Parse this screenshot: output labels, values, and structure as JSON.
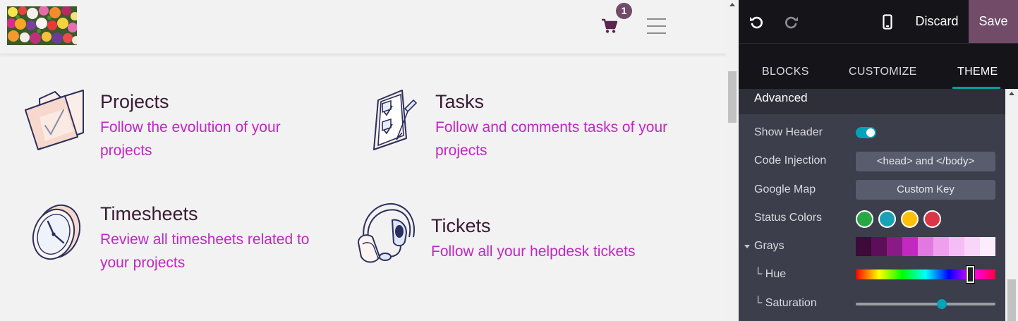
{
  "header": {
    "cart_count": "1",
    "logo_icon": "flower-photo",
    "cart_icon": "shopping-cart-icon",
    "menu_icon": "hamburger-menu-icon"
  },
  "features": [
    {
      "title": "Projects",
      "description": "Follow the evolution of your projects",
      "icon": "folder-check-icon"
    },
    {
      "title": "Tasks",
      "description": "Follow and comments tasks of your projects",
      "icon": "checklist-clipboard-icon"
    },
    {
      "title": "Timesheets",
      "description": "Review all timesheets related to your projects",
      "icon": "clock-icon"
    },
    {
      "title": "Tickets",
      "description": "Follow all your helpdesk tickets",
      "icon": "headset-icon"
    }
  ],
  "editor": {
    "toolbar": {
      "undo_icon": "undo-icon",
      "redo_icon": "redo-icon",
      "mobile_icon": "mobile-phone-icon",
      "discard_label": "Discard",
      "save_label": "Save"
    },
    "tabs": [
      {
        "label": "BLOCKS",
        "active": false
      },
      {
        "label": "CUSTOMIZE",
        "active": false
      },
      {
        "label": "THEME",
        "active": true
      }
    ],
    "section_title": "Advanced",
    "options": {
      "show_header": {
        "label": "Show Header",
        "enabled": true
      },
      "code_injection": {
        "label": "Code Injection",
        "button": "<head> and </body>"
      },
      "google_map": {
        "label": "Google Map",
        "button": "Custom Key"
      },
      "status_colors": {
        "label": "Status Colors",
        "colors": [
          "#28a745",
          "#17a2b8",
          "#ffc107",
          "#dc3545"
        ]
      },
      "grays": {
        "label": "Grays",
        "swatches": [
          "#3d0a3a",
          "#5c0f58",
          "#8a1b86",
          "#c229c0",
          "#e279e0",
          "#eea0ee",
          "#f5bdf5",
          "#f9d6f9",
          "#fcedfc"
        ]
      },
      "hue": {
        "label": "└ Hue",
        "value_percent": 82
      },
      "saturation": {
        "label": "└ Saturation",
        "value_percent": 62
      }
    }
  },
  "colors": {
    "accent": "#714b67",
    "heading": "#3b1a36",
    "link": "#c126c4",
    "toggle": "#00a3b8"
  }
}
